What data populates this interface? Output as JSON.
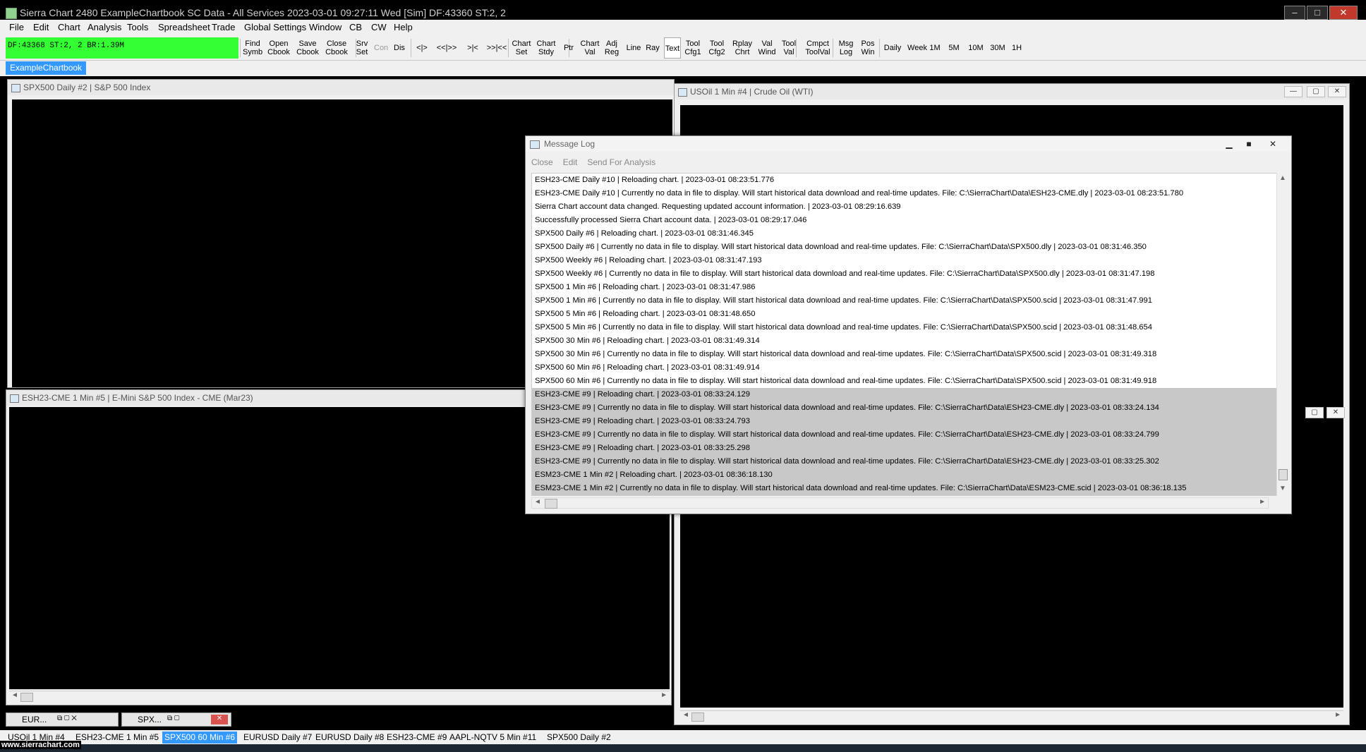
{
  "window": {
    "title": "Sierra Chart 2480 ExampleChartbook  SC Data - All Services 2023-03-01  09:27:11 Wed [Sim]  DF:43360  ST:2, 2",
    "min": "–",
    "max": "□",
    "close": "✕"
  },
  "menu": [
    "File",
    "Edit",
    "Chart",
    "Analysis",
    "Tools",
    "Spreadsheet",
    "Trade",
    "Global Settings",
    "Window",
    "CB",
    "CW",
    "Help"
  ],
  "toolbar": {
    "status": "DF:43368  ST:2, 2  BR:1.39M",
    "buttons": [
      "Find\nSymb",
      "Open\nCbook",
      "Save\nCbook",
      "Close\nCbook",
      "Srv\nSet",
      "Con",
      "Dis",
      "<|>",
      "<<|>>",
      ">|<",
      ">>|<<",
      "Chart\nSet",
      "Chart\nStdy",
      "Ptr",
      "Chart\nVal",
      "Adj\nReg",
      "Line",
      "Ray",
      "Text",
      "Tool\nCfg1",
      "Tool\nCfg2",
      "Rplay\nChrt",
      "Val\nWind",
      "Tool\nVal",
      "Cmpct\nToolVal",
      "Msg\nLog",
      "Pos\nWin",
      "Daily",
      "Week",
      "1M",
      "5M",
      "10M",
      "30M",
      "1H"
    ]
  },
  "chartbook_tab": "ExampleChartbook",
  "windows": {
    "spx_daily": "SPX500  Daily  #2 | S&P 500 Index",
    "usoil": "USOil  1 Min   #4 | Crude Oil (WTI)",
    "esh23": "ESH23-CME  1 Min   #5 | E-Mini S&P 500 Index - CME (Mar23)"
  },
  "message_log": {
    "title": "Message Log",
    "menu": [
      "Close",
      "Edit",
      "Send For Analysis"
    ],
    "lines": [
      {
        "text": "ESH23-CME  Daily  #10 | Reloading chart. | 2023-03-01  08:23:51.776",
        "hl": false
      },
      {
        "text": "ESH23-CME  Daily  #10 | Currently no data in file to display. Will start historical data download and real-time updates. File: C:\\SierraChart\\Data\\ESH23-CME.dly | 2023-03-01  08:23:51.780",
        "hl": false
      },
      {
        "text": "Sierra Chart account data changed. Requesting updated account information. | 2023-03-01  08:29:16.639",
        "hl": false
      },
      {
        "text": "Successfully processed Sierra Chart account data. | 2023-03-01  08:29:17.046",
        "hl": false
      },
      {
        "text": "SPX500  Daily  #6 | Reloading chart. | 2023-03-01  08:31:46.345",
        "hl": false
      },
      {
        "text": "SPX500  Daily  #6 | Currently no data in file to display. Will start historical data download and real-time updates. File: C:\\SierraChart\\Data\\SPX500.dly | 2023-03-01  08:31:46.350",
        "hl": false
      },
      {
        "text": "SPX500  Weekly  #6 | Reloading chart. | 2023-03-01  08:31:47.193",
        "hl": false
      },
      {
        "text": "SPX500  Weekly  #6 | Currently no data in file to display. Will start historical data download and real-time updates. File: C:\\SierraChart\\Data\\SPX500.dly | 2023-03-01  08:31:47.198",
        "hl": false
      },
      {
        "text": "SPX500  1 Min   #6 | Reloading chart. | 2023-03-01  08:31:47.986",
        "hl": false
      },
      {
        "text": "SPX500  1 Min   #6 | Currently no data in file to display. Will start historical data download and real-time updates. File: C:\\SierraChart\\Data\\SPX500.scid | 2023-03-01  08:31:47.991",
        "hl": false
      },
      {
        "text": "SPX500  5 Min   #6 | Reloading chart. | 2023-03-01  08:31:48.650",
        "hl": false
      },
      {
        "text": "SPX500  5 Min   #6 | Currently no data in file to display. Will start historical data download and real-time updates. File: C:\\SierraChart\\Data\\SPX500.scid | 2023-03-01  08:31:48.654",
        "hl": false
      },
      {
        "text": "SPX500  30 Min   #6 | Reloading chart. | 2023-03-01  08:31:49.314",
        "hl": false
      },
      {
        "text": "SPX500  30 Min   #6 | Currently no data in file to display. Will start historical data download and real-time updates. File: C:\\SierraChart\\Data\\SPX500.scid | 2023-03-01  08:31:49.318",
        "hl": false
      },
      {
        "text": "SPX500  60 Min   #6 | Reloading chart. | 2023-03-01  08:31:49.914",
        "hl": false
      },
      {
        "text": "SPX500  60 Min   #6 | Currently no data in file to display. Will start historical data download and real-time updates. File: C:\\SierraChart\\Data\\SPX500.scid | 2023-03-01  08:31:49.918",
        "hl": false
      },
      {
        "text": "ESH23-CME  #9 | Reloading chart. | 2023-03-01  08:33:24.129",
        "hl": true
      },
      {
        "text": "ESH23-CME  #9 | Currently no data in file to display. Will start historical data download and real-time updates. File: C:\\SierraChart\\Data\\ESH23-CME.dly | 2023-03-01  08:33:24.134",
        "hl": true
      },
      {
        "text": "ESH23-CME  #9 | Reloading chart. | 2023-03-01  08:33:24.793",
        "hl": true
      },
      {
        "text": "ESH23-CME  #9 | Currently no data in file to display. Will start historical data download and real-time updates. File: C:\\SierraChart\\Data\\ESH23-CME.dly | 2023-03-01  08:33:24.799",
        "hl": true
      },
      {
        "text": "ESH23-CME  #9 | Reloading chart. | 2023-03-01  08:33:25.298",
        "hl": true
      },
      {
        "text": "ESH23-CME  #9 | Currently no data in file to display. Will start historical data download and real-time updates. File: C:\\SierraChart\\Data\\ESH23-CME.dly | 2023-03-01  08:33:25.302",
        "hl": true
      },
      {
        "text": "ESM23-CME  1 Min   #2 | Reloading chart. | 2023-03-01  08:36:18.130",
        "hl": true
      },
      {
        "text": "ESM23-CME  1 Min   #2 | Currently no data in file to display. Will start historical data download and real-time updates. File: C:\\SierraChart\\Data\\ESM23-CME.scid | 2023-03-01  08:36:18.135",
        "hl": true
      }
    ]
  },
  "minimized": [
    {
      "label": "EUR..."
    },
    {
      "label": "SPX..."
    }
  ],
  "chart_tabs": [
    {
      "label": "USOil  1 Min   #4",
      "active": false
    },
    {
      "label": "ESH23-CME  1 Min   #5",
      "active": false
    },
    {
      "label": "SPX500  60 Min   #6",
      "active": true
    },
    {
      "label": "EURUSD  Daily  #7",
      "active": false
    },
    {
      "label": "EURUSD  Daily  #8",
      "active": false
    },
    {
      "label": "ESH23-CME  #9",
      "active": false
    },
    {
      "label": "AAPL-NQTV  5 Min  #11",
      "active": false
    },
    {
      "label": "SPX500  Daily  #2",
      "active": false
    }
  ],
  "watermark": "www.sierrachart.com"
}
